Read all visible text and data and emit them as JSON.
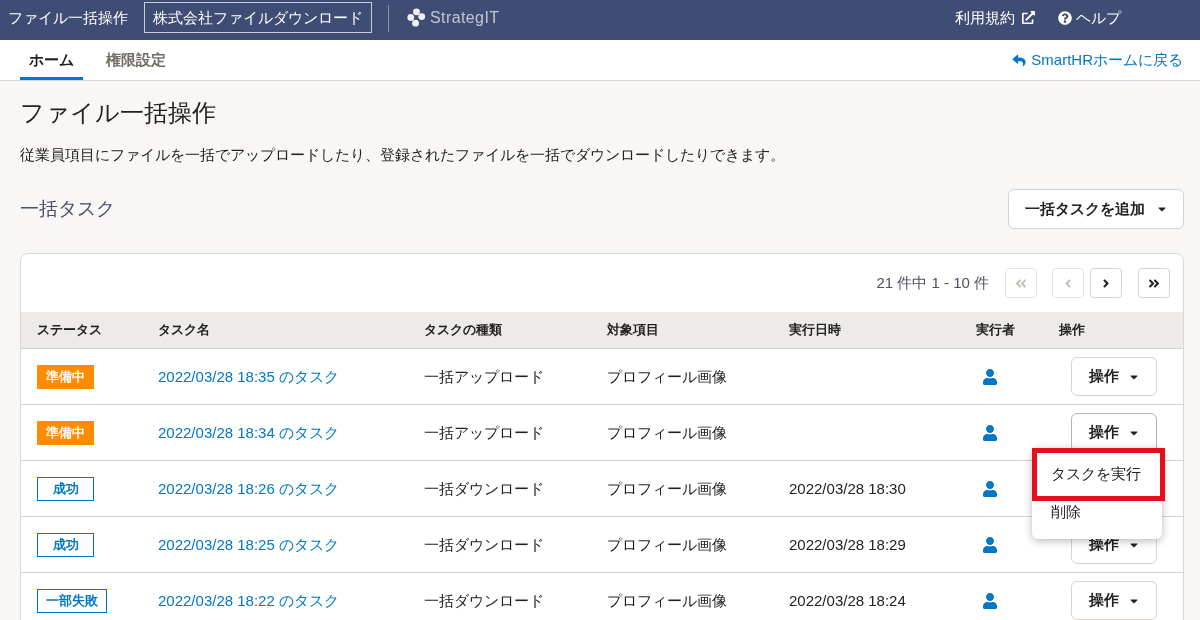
{
  "header": {
    "title": "ファイル一括操作",
    "company": "株式会社ファイルダウンロード",
    "brand": "StrategIT",
    "links": [
      {
        "kind": "terms",
        "label": "利用規約"
      },
      {
        "kind": "help",
        "label": "ヘルプ"
      }
    ]
  },
  "tabs": [
    {
      "label": "ホーム",
      "selected": true
    },
    {
      "label": "権限設定",
      "selected": false
    }
  ],
  "back_link": "SmartHRホームに戻る",
  "page": {
    "title": "ファイル一括操作",
    "description": "従業員項目にファイルを一括でアップロードしたり、登録されたファイルを一括でダウンロードしたりできます。"
  },
  "section": {
    "title": "一括タスク",
    "add_button": "一括タスクを追加"
  },
  "pagination": {
    "summary": "21 件中 1 - 10 件",
    "buttons": [
      {
        "kind": "first",
        "disabled": true
      },
      {
        "kind": "prev",
        "disabled": true
      },
      {
        "kind": "next",
        "disabled": false
      },
      {
        "kind": "last",
        "disabled": false
      }
    ]
  },
  "table": {
    "columns": [
      "ステータス",
      "タスク名",
      "タスクの種類",
      "対象項目",
      "実行日時",
      "実行者",
      "操作"
    ],
    "rows": [
      {
        "status": {
          "label": "準備中",
          "kind": "preparing"
        },
        "name": "2022/03/28 18:35 のタスク",
        "type": "一括アップロード",
        "target": "プロフィール画像",
        "action": {
          "label": "操作",
          "expanded": false
        }
      },
      {
        "status": {
          "label": "準備中",
          "kind": "preparing"
        },
        "name": "2022/03/28 18:34 のタスク",
        "type": "一括アップロード",
        "target": "プロフィール画像",
        "action": {
          "label": "操作",
          "expanded": true,
          "menu": [
            {
              "label": "タスクを実行",
              "highlighted": true
            },
            {
              "label": "削除",
              "highlighted": false
            }
          ]
        }
      },
      {
        "status": {
          "label": "成功",
          "kind": "success"
        },
        "name": "2022/03/28 18:26 のタスク",
        "type": "一括ダウンロード",
        "target": "プロフィール画像",
        "executed_at": "2022/03/28 18:30"
      },
      {
        "status": {
          "label": "成功",
          "kind": "success"
        },
        "name": "2022/03/28 18:25 のタスク",
        "type": "一括ダウンロード",
        "target": "プロフィール画像",
        "executed_at": "2022/03/28 18:29",
        "action": {
          "label": "操作",
          "expanded": false
        }
      },
      {
        "status": {
          "label": "一部失敗",
          "kind": "partial_failure"
        },
        "name": "2022/03/28 18:22 のタスク",
        "type": "一括ダウンロード",
        "target": "プロフィール画像",
        "executed_at": "2022/03/28 18:24",
        "action": {
          "label": "操作",
          "expanded": false
        }
      }
    ]
  }
}
